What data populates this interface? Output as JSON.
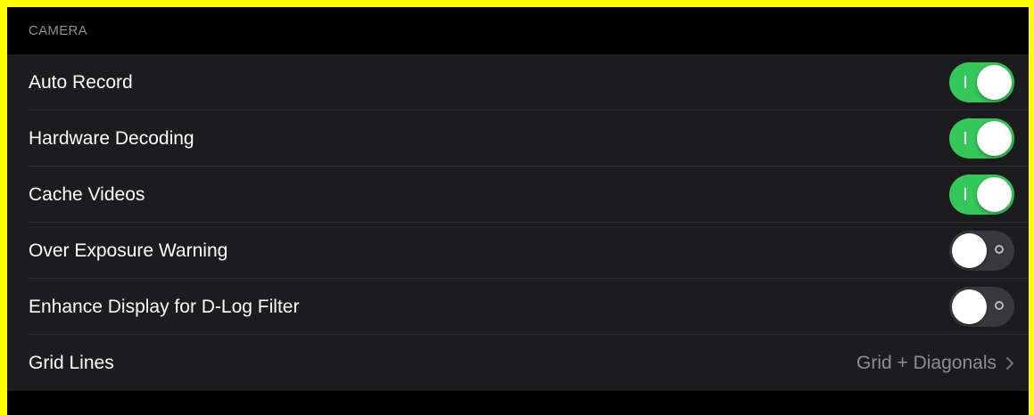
{
  "section": {
    "title": "CAMERA"
  },
  "rows": [
    {
      "label": "Auto Record",
      "control": "toggle",
      "on": true
    },
    {
      "label": "Hardware Decoding",
      "control": "toggle",
      "on": true
    },
    {
      "label": "Cache Videos",
      "control": "toggle",
      "on": true
    },
    {
      "label": "Over Exposure Warning",
      "control": "toggle",
      "on": false
    },
    {
      "label": "Enhance Display for D-Log Filter",
      "control": "toggle",
      "on": false
    },
    {
      "label": "Grid Lines",
      "control": "disclosure",
      "value": "Grid + Diagonals"
    }
  ],
  "colors": {
    "switch_on": "#34c759",
    "switch_off": "#39393d",
    "row_background": "#1c1c1e",
    "outer_border": "#ffff00"
  },
  "icons": {
    "disclosure": "chevron-right-icon"
  }
}
